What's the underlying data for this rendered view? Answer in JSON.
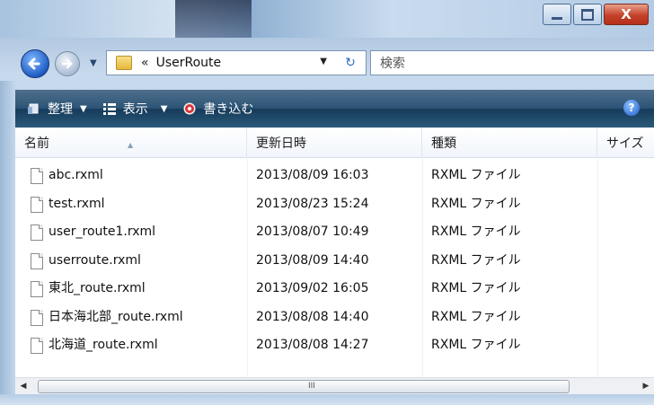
{
  "window": {
    "controls": {
      "close_label": "X"
    }
  },
  "address": {
    "chevron": "«",
    "path": "UserRoute",
    "search_placeholder": "検索"
  },
  "toolbar": {
    "organize": "整理",
    "view": "表示",
    "burn": "書き込む",
    "help": "?"
  },
  "columns": [
    "名前",
    "更新日時",
    "種類",
    "サイズ"
  ],
  "files": [
    {
      "name": "abc.rxml",
      "date": "2013/08/09 16:03",
      "type": "RXML ファイル"
    },
    {
      "name": "test.rxml",
      "date": "2013/08/23 15:24",
      "type": "RXML ファイル"
    },
    {
      "name": "user_route1.rxml",
      "date": "2013/08/07 10:49",
      "type": "RXML ファイル"
    },
    {
      "name": "userroute.rxml",
      "date": "2013/08/09 14:40",
      "type": "RXML ファイル"
    },
    {
      "name": "東北_route.rxml",
      "date": "2013/09/02 16:05",
      "type": "RXML ファイル"
    },
    {
      "name": "日本海北部_route.rxml",
      "date": "2013/08/08 14:40",
      "type": "RXML ファイル"
    },
    {
      "name": "北海道_route.rxml",
      "date": "2013/08/08 14:27",
      "type": "RXML ファイル"
    }
  ],
  "scrollbar": {
    "grip": "III"
  },
  "colors": {
    "accent": "#1f5dc4",
    "cmdbar": "#2d5577"
  }
}
